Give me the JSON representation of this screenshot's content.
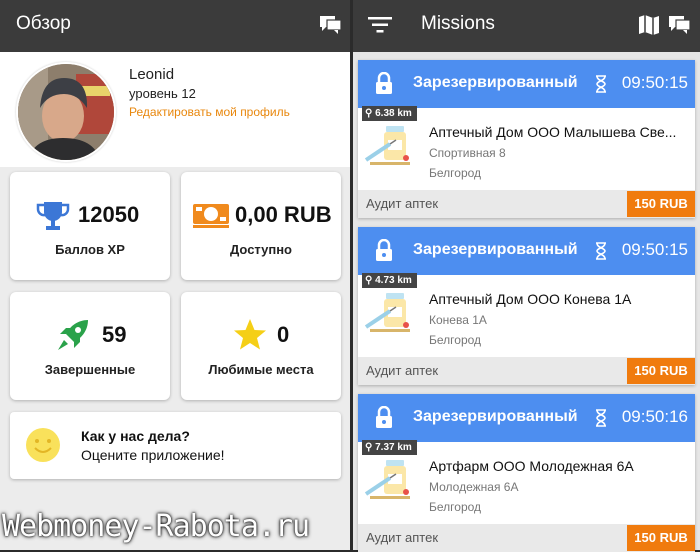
{
  "overview": {
    "title": "Обзор",
    "profile": {
      "name": "Leonid",
      "level": "уровень 12",
      "edit_link": "Редактировать мой профиль"
    },
    "stats": [
      {
        "icon": "trophy-icon",
        "value": "12050",
        "label": "Баллов XP"
      },
      {
        "icon": "money-icon",
        "value": "0,00 RUB",
        "label": "Доступно"
      },
      {
        "icon": "rocket-icon",
        "value": "59",
        "label": "Завершенные"
      },
      {
        "icon": "star-icon",
        "value": "0",
        "label": "Любимые места"
      }
    ],
    "rate": {
      "question": "Как у нас дела?",
      "subtitle": "Оцените приложение!"
    }
  },
  "missions": {
    "title": "Missions",
    "items": [
      {
        "status": "Зарезервированный",
        "time": "09:50:15",
        "distance": "6.38 km",
        "name": "Аптечный Дом ООО Малышева Све...",
        "address": "Спортивная 8",
        "city": "Белгород",
        "category": "Аудит аптек",
        "price": "150 RUB"
      },
      {
        "status": "Зарезервированный",
        "time": "09:50:15",
        "distance": "4.73 km",
        "name": "Аптечный Дом ООО Конева 1А",
        "address": "Конева 1А",
        "city": "Белгород",
        "category": "Аудит аптек",
        "price": "150 RUB"
      },
      {
        "status": "Зарезервированный",
        "time": "09:50:16",
        "distance": "7.37 km",
        "name": "Артфарм ООО Молодежная 6А",
        "address": "Молодежная 6А",
        "city": "Белгород",
        "category": "Аудит аптек",
        "price": "150 RUB"
      }
    ]
  },
  "watermark": "Webmoney-Rabota.ru",
  "colors": {
    "accent_blue": "#4d8ef0",
    "accent_orange": "#f07b0e",
    "link_orange": "#e8870d",
    "topbar": "#3b3b3b"
  }
}
